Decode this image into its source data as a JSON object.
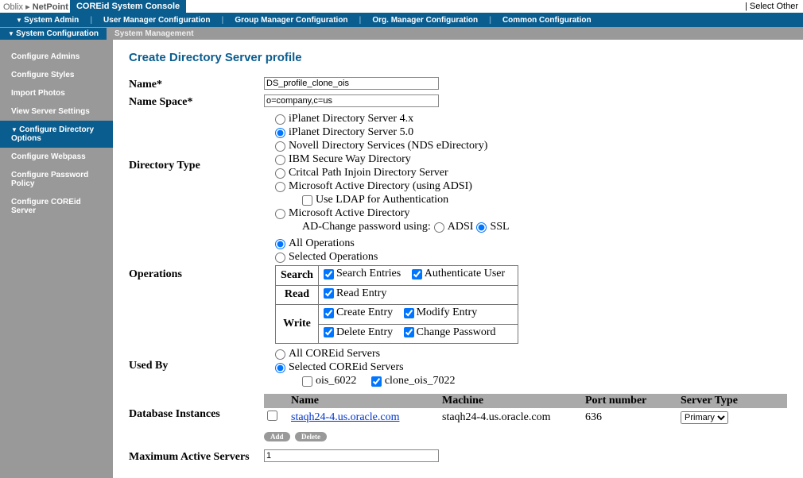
{
  "top": {
    "brand_a": "Oblix",
    "brand_b": "NetPoint",
    "tab": "COREid System Console",
    "select_other": "| Select Other"
  },
  "nav": {
    "items": [
      "System Admin",
      "User Manager Configuration",
      "Group Manager Configuration",
      "Org. Manager Configuration",
      "Common Configuration"
    ]
  },
  "subnav": {
    "active": "System Configuration",
    "other": "System Management"
  },
  "sidebar": {
    "items": [
      {
        "label": "Configure Admins",
        "sel": false
      },
      {
        "label": "Configure Styles",
        "sel": false
      },
      {
        "label": "Import Photos",
        "sel": false
      },
      {
        "label": "View Server Settings",
        "sel": false
      },
      {
        "label": "Configure Directory Options",
        "sel": true
      },
      {
        "label": "Configure Webpass",
        "sel": false
      },
      {
        "label": "Configure Password Policy",
        "sel": false
      },
      {
        "label": "Configure COREid Server",
        "sel": false
      }
    ]
  },
  "page": {
    "title": "Create Directory Server profile",
    "name_label": "Name*",
    "name_value": "DS_profile_clone_ois",
    "namespace_label": "Name Space*",
    "namespace_value": "o=company,c=us",
    "dirtype_label": "Directory Type",
    "dirtypes": [
      "iPlanet Directory Server 4.x",
      "iPlanet Directory Server 5.0",
      "Novell Directory Services (NDS eDirectory)",
      "IBM Secure Way Directory",
      "Critcal Path Injoin Directory Server",
      "Microsoft Active Directory (using ADSI)"
    ],
    "dirtype_selected": 1,
    "ldap_check": "Use LDAP for Authentication",
    "msad": "Microsoft Active Directory",
    "adchange": "AD-Change password using:",
    "adsi": "ADSI",
    "ssl": "SSL",
    "ops_label": "Operations",
    "ops_all": "All Operations",
    "ops_sel": "Selected Operations",
    "ops_table": {
      "search": "Search",
      "read": "Read",
      "write": "Write",
      "search_entries": "Search Entries",
      "auth_user": "Authenticate User",
      "read_entry": "Read Entry",
      "create_entry": "Create Entry",
      "modify_entry": "Modify Entry",
      "delete_entry": "Delete Entry",
      "change_pw": "Change Password"
    },
    "usedby_label": "Used By",
    "usedby_all": "All COREid Servers",
    "usedby_sel": "Selected COREid Servers",
    "usedby_opts": [
      {
        "label": "ois_6022",
        "checked": false
      },
      {
        "label": "clone_ois_7022",
        "checked": true
      }
    ],
    "db_label": "Database Instances",
    "db_head": {
      "name": "Name",
      "machine": "Machine",
      "port": "Port number",
      "type": "Server Type"
    },
    "db_rows": [
      {
        "name": "staqh24-4.us.oracle.com",
        "machine": "staqh24-4.us.oracle.com",
        "port": "636",
        "type": "Primary"
      }
    ],
    "btn_add": "Add",
    "btn_del": "Delete",
    "maxactive_label": "Maximum Active Servers",
    "maxactive_value": "1"
  }
}
